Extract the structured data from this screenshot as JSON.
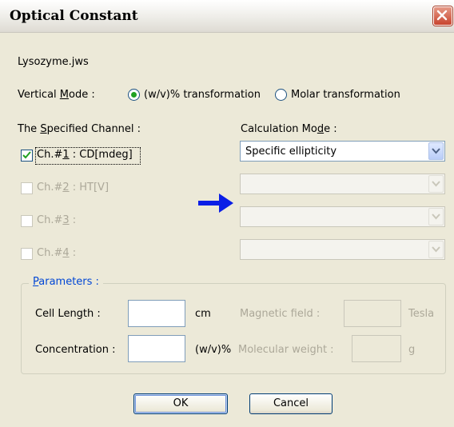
{
  "window": {
    "title": "Optical Constant"
  },
  "file_name": "Lysozyme.jws",
  "vertical_mode": {
    "label_pre": "Vertical ",
    "label_accel": "M",
    "label_post": "ode :",
    "options": [
      {
        "label": "(w/v)% transformation",
        "selected": true
      },
      {
        "label": "Molar transformation",
        "selected": false
      }
    ]
  },
  "channels": {
    "header_pre": "The ",
    "header_accel": "S",
    "header_post": "pecified Channel :",
    "items": [
      {
        "pre": "Ch.#",
        "accel": "1",
        "post": " : CD[mdeg]",
        "checked": true,
        "enabled": true
      },
      {
        "pre": "Ch.#",
        "accel": "2",
        "post": " : HT[V]",
        "checked": false,
        "enabled": false
      },
      {
        "pre": "Ch.#",
        "accel": "3",
        "post": " :",
        "checked": false,
        "enabled": false
      },
      {
        "pre": "Ch.#",
        "accel": "4",
        "post": " :",
        "checked": false,
        "enabled": false
      }
    ]
  },
  "calculation_mode": {
    "header_pre": "Calculation Mo",
    "header_accel": "d",
    "header_post": "e :",
    "combos": [
      {
        "value": "Specific ellipticity",
        "enabled": true
      },
      {
        "value": "",
        "enabled": false
      },
      {
        "value": "",
        "enabled": false
      },
      {
        "value": "",
        "enabled": false
      }
    ]
  },
  "parameters": {
    "label_accel": "P",
    "label_post": "arameters :",
    "cell_length": {
      "label": "Cell Length :",
      "value": "",
      "unit": "cm"
    },
    "concentration": {
      "label": "Concentration :",
      "value": "",
      "unit": "(w/v)%"
    },
    "magnetic_field": {
      "label": "Magnetic field :",
      "value": "",
      "unit": "Tesla"
    },
    "molecular_weight": {
      "label": "Molecular weight :",
      "value": "",
      "unit": "g"
    }
  },
  "buttons": {
    "ok": "OK",
    "cancel": "Cancel"
  },
  "colors": {
    "arrow": "#0a1ee6",
    "radio_selected": "#21a121",
    "check_mark": "#21a121",
    "group_label": "#0046d5"
  },
  "icons": {
    "close": "close-icon",
    "arrow": "arrow-right-icon",
    "dropdown": "chevron-down-icon"
  }
}
